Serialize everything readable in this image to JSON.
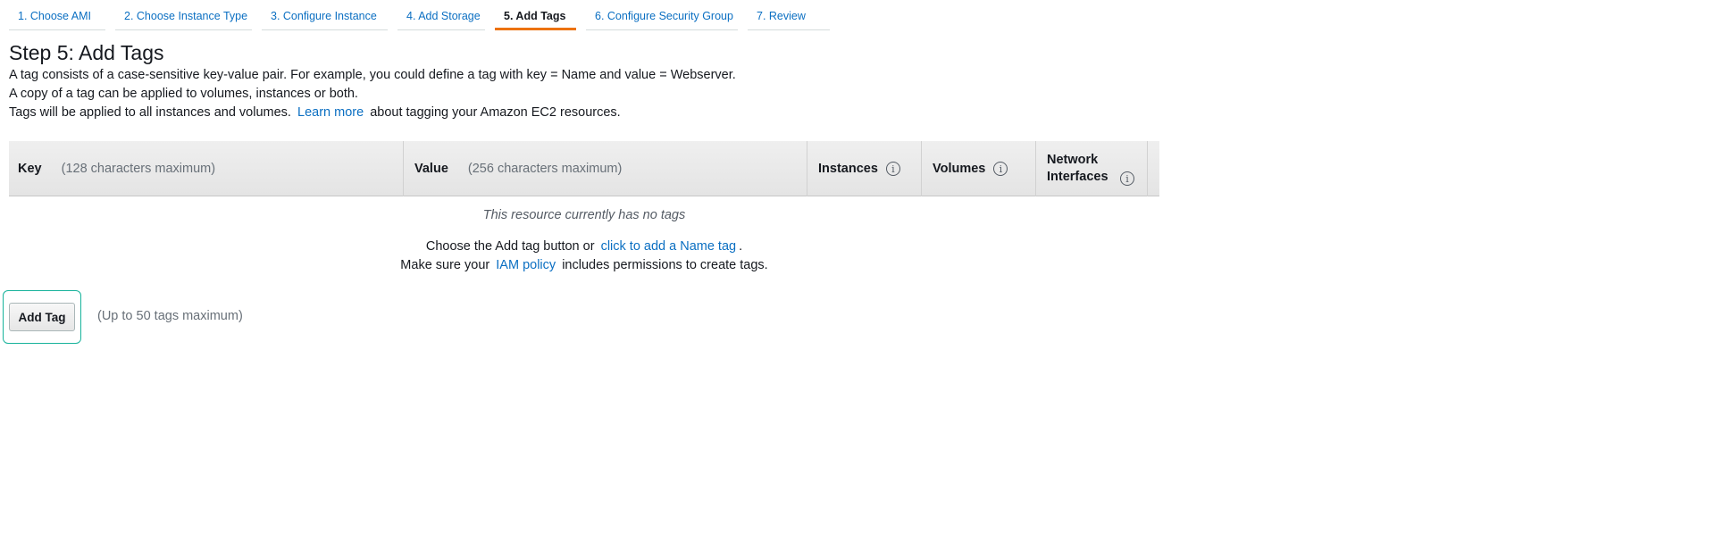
{
  "wizard_steps": [
    {
      "label": "1. Choose AMI"
    },
    {
      "label": "2. Choose Instance Type"
    },
    {
      "label": "3. Configure Instance"
    },
    {
      "label": "4. Add Storage"
    },
    {
      "label": "5. Add Tags",
      "active": true
    },
    {
      "label": "6. Configure Security Group"
    },
    {
      "label": "7. Review"
    }
  ],
  "page": {
    "title": "Step 5: Add Tags",
    "line1": "A tag consists of a case-sensitive key-value pair. For example, you could define a tag with key = Name and value = Webserver.",
    "line2": "A copy of a tag can be applied to volumes, instances or both.",
    "line3_before": "Tags will be applied to all instances and volumes.",
    "line3_link": "Learn more",
    "line3_after": "about tagging your Amazon EC2 resources."
  },
  "table": {
    "columns": {
      "key": "Key",
      "key_hint": "(128 characters maximum)",
      "value": "Value",
      "value_hint": "(256 characters maximum)",
      "instances": "Instances",
      "volumes": "Volumes",
      "network_interfaces": "Network Interfaces"
    },
    "info_glyph": "i",
    "empty_message": "This resource currently has no tags",
    "hint1_before": "Choose the Add tag button or",
    "hint1_link": "click to add a Name tag",
    "hint1_after": ".",
    "hint2_before": "Make sure your",
    "hint2_link": "IAM policy",
    "hint2_after": "includes permissions to create tags."
  },
  "add_tag": {
    "button_label": "Add Tag",
    "note": "(Up to 50 tags maximum)"
  },
  "colors": {
    "link": "#0b6fc2",
    "active_step_underline": "#ec7211",
    "focus_ring": "#17b39b"
  }
}
